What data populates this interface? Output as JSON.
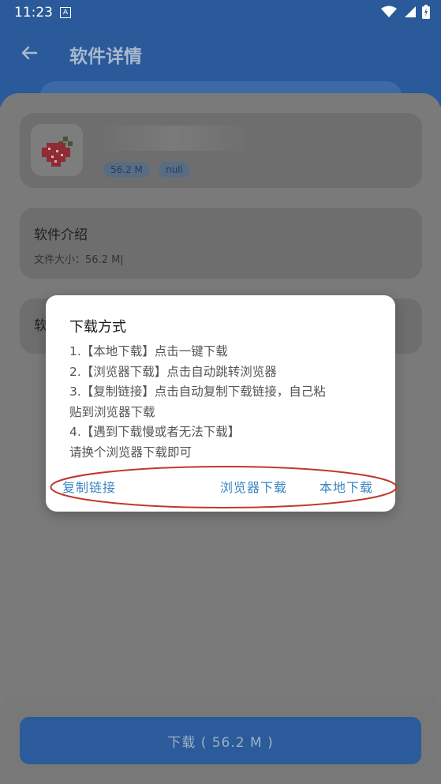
{
  "status_bar": {
    "time": "11:23",
    "notification": "A"
  },
  "toolbar": {
    "title": "软件详情"
  },
  "app": {
    "size_chip": "56.2 M",
    "extra_chip": "null"
  },
  "intro_card": {
    "title": "软件介绍",
    "body": "文件大小：56.2 M|"
  },
  "third_card": {
    "title": "软"
  },
  "dialog": {
    "title": "下载方式",
    "lines": [
      "1.【本地下载】点击一键下载",
      "2.【浏览器下载】点击自动跳转浏览器",
      "3.【复制链接】点击自动复制下载链接，自己粘",
      "贴到浏览器下载",
      "4.【遇到下载慢或者无法下载】",
      "请换个浏览器下载即可"
    ],
    "actions": {
      "copy": "复制链接",
      "browser": "浏览器下载",
      "local": "本地下载"
    }
  },
  "download_button": {
    "label": "下载 ( 56.2 M )"
  },
  "colors": {
    "accent": "#3b84c4",
    "header": "#2a5a99",
    "annotation": "#c0392b"
  },
  "icons": [
    "back-arrow-icon",
    "wifi-icon",
    "signal-icon",
    "battery-icon",
    "strawberry-app-icon"
  ]
}
